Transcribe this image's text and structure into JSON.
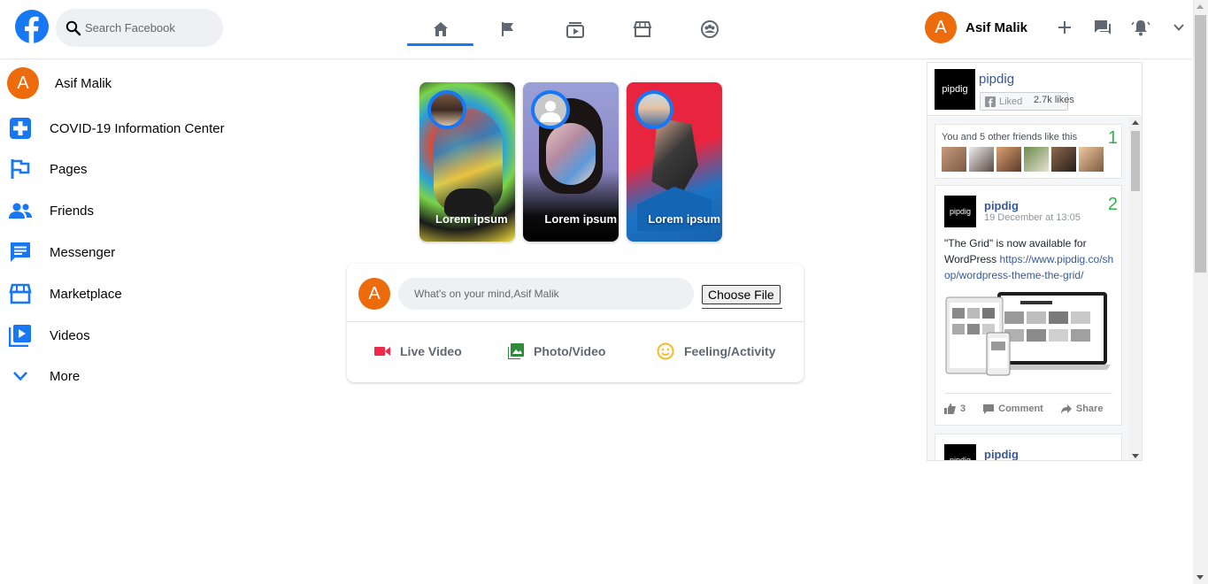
{
  "header": {
    "logo_icon": "facebook-logo",
    "search": {
      "placeholder": "Search Facebook",
      "icon": "search-icon"
    },
    "nav_tabs": [
      {
        "icon": "home-icon",
        "active": true
      },
      {
        "icon": "flag-icon",
        "active": false
      },
      {
        "icon": "watch-icon",
        "active": false
      },
      {
        "icon": "marketplace-icon",
        "active": false
      },
      {
        "icon": "groups-icon",
        "active": false
      }
    ],
    "user": {
      "initial": "A",
      "name": "Asif Malik"
    },
    "actions": [
      "plus-icon",
      "messenger-icon",
      "notifications-icon",
      "chevron-down-icon"
    ]
  },
  "sidebar": {
    "profile": {
      "initial": "A",
      "name": "Asif Malik"
    },
    "items": [
      {
        "label": "COVID-19 Information Center",
        "icon": "covid-plus-icon"
      },
      {
        "label": "Pages",
        "icon": "flag-icon"
      },
      {
        "label": "Friends",
        "icon": "friends-icon"
      },
      {
        "label": "Messenger",
        "icon": "messenger-icon"
      },
      {
        "label": "Marketplace",
        "icon": "marketplace-icon"
      },
      {
        "label": "Videos",
        "icon": "video-icon"
      },
      {
        "label": "More",
        "icon": "chevron-down-icon"
      }
    ]
  },
  "stories": [
    {
      "label": "Lorem ipsum"
    },
    {
      "label": "Lorem ipsum"
    },
    {
      "label": "Lorem ipsum"
    }
  ],
  "composer": {
    "initial": "A",
    "placeholder": "What's on your mind,Asif Malik",
    "file_button": "Choose File",
    "actions": [
      {
        "label": "Live Video",
        "icon": "live-video-icon",
        "color": "#f02849"
      },
      {
        "label": "Photo/Video",
        "icon": "photo-icon",
        "color": "#45bd62"
      },
      {
        "label": "Feeling/Activity",
        "icon": "feeling-icon",
        "color": "#f7b928"
      }
    ]
  },
  "widget": {
    "page_name": "pipdig",
    "logo_text": "pipdig",
    "liked_label": "Liked",
    "likes": "2.7k likes",
    "friends_text": "You and 5 other friends like this",
    "badge_1": "1",
    "badge_2": "2",
    "post": {
      "author": "pipdig",
      "date": "19 December at 13:05",
      "text": "\"The Grid\" is now available for WordPress ",
      "link": "https://www.pipdig.co/shop/wordpress-theme-the-grid/",
      "likes": "3",
      "comment": "Comment",
      "share": "Share"
    },
    "next_post_author": "pipdig"
  },
  "colors": {
    "brand": "#1877f2",
    "avatar": "#ec6b0d",
    "page_link": "#385898",
    "badge": "#2fb24c"
  }
}
